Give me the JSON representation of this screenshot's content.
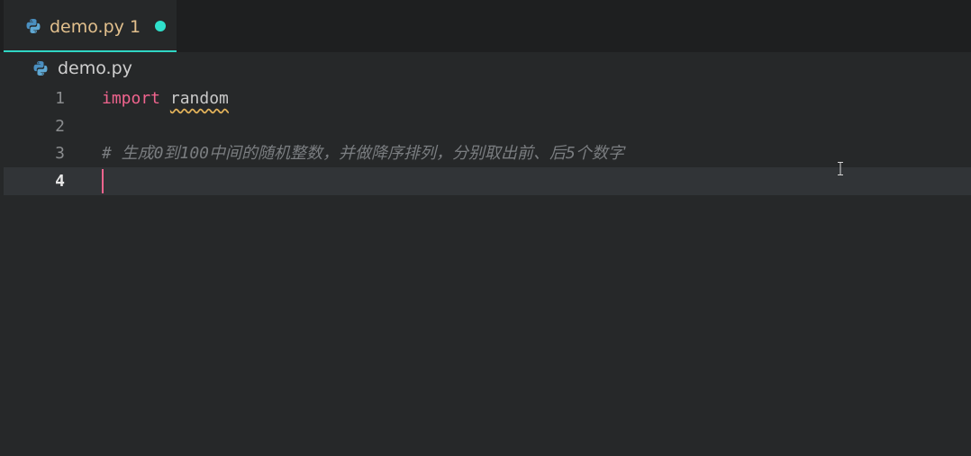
{
  "editor_tab": {
    "filename": "demo.py",
    "problem_count": "1",
    "icon": "python-icon",
    "modified_dot_color": "#2fe0cb"
  },
  "breadcrumb": {
    "filename": "demo.py",
    "icon": "python-icon"
  },
  "code_lines": [
    {
      "number": "1",
      "keyword": "import",
      "module": "random"
    },
    {
      "number": "2"
    },
    {
      "number": "3",
      "comment": "# 生成0到100中间的随机整数，并做降序排列，分别取出前、后5个数字"
    },
    {
      "number": "4",
      "current": true
    }
  ],
  "colors": {
    "keyword": "#f0648e",
    "comment": "#7a7d80",
    "tab_label": "#e2c08d",
    "squiggle_warning": "#e2b25a"
  }
}
